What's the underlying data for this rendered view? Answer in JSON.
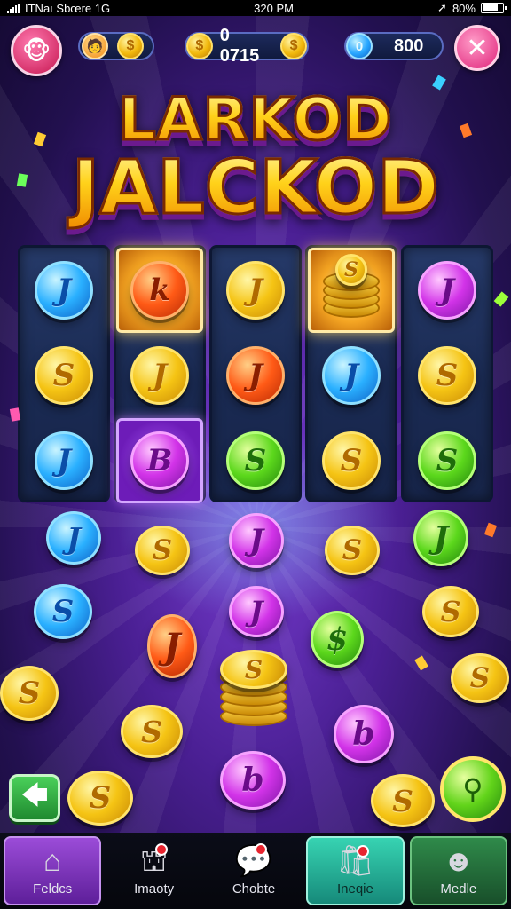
{
  "status_bar": {
    "carrier": "ITNaı Sbœre 1G",
    "time": "320 PM",
    "battery": "80%"
  },
  "hud": {
    "coin_balance": "0 0715",
    "gem_balance": "800",
    "close_symbol": "✕"
  },
  "title": {
    "line1": "LARKOD",
    "line2": "JALCKOD"
  },
  "reels": [
    [
      {
        "color": "blue",
        "glyph": "J"
      },
      {
        "color": "gold",
        "glyph": "S"
      },
      {
        "color": "blue",
        "glyph": "J"
      }
    ],
    [
      {
        "color": "orange",
        "glyph": "k",
        "highlight": "gold"
      },
      {
        "color": "gold",
        "glyph": "J"
      },
      {
        "color": "pink",
        "glyph": "B",
        "highlight": "purple"
      }
    ],
    [
      {
        "color": "gold",
        "glyph": "J"
      },
      {
        "color": "orange",
        "glyph": "J"
      },
      {
        "color": "green",
        "glyph": "S"
      }
    ],
    [
      {
        "color": "stack",
        "glyph": "S",
        "highlight": "gold"
      },
      {
        "color": "blue",
        "glyph": "J"
      },
      {
        "color": "gold",
        "glyph": "S"
      }
    ],
    [
      {
        "color": "pink",
        "glyph": "J"
      },
      {
        "color": "gold",
        "glyph": "S"
      },
      {
        "color": "green",
        "glyph": "S"
      }
    ]
  ],
  "nav": [
    {
      "label": "Feldcs",
      "icon": "home-icon"
    },
    {
      "label": "Imaoty",
      "icon": "inventory-icon",
      "badge": true
    },
    {
      "label": "Chobte",
      "icon": "chat-icon",
      "badge": true
    },
    {
      "label": "Ineqie",
      "icon": "shop-icon",
      "badge": true
    },
    {
      "label": "Medle",
      "icon": "profile-icon"
    }
  ],
  "colors": {
    "gold": "#f5c414",
    "blue": "#2ab0ff",
    "green": "#5cd81c",
    "pink": "#d233e8",
    "orange": "#ff5a16",
    "background": "#4a1f93"
  }
}
